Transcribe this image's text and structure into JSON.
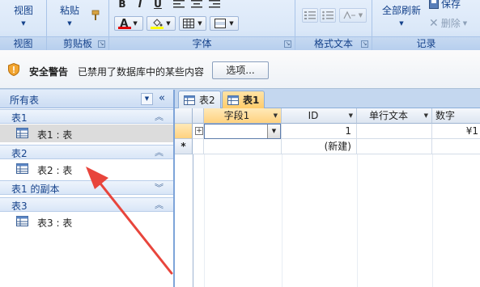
{
  "ribbon": {
    "groups": {
      "views": {
        "label": "视图",
        "button": "视图"
      },
      "clipboard": {
        "label": "剪贴板",
        "paste": "粘贴"
      },
      "font": {
        "label": "字体",
        "bold": "B",
        "italic": "I",
        "underline": "U",
        "font_color_glyph": "A"
      },
      "rich_text": {
        "label": "格式文本"
      },
      "records": {
        "label": "记录",
        "refresh": "全部刷新",
        "save": "保存",
        "delete": "删除"
      }
    }
  },
  "message_bar": {
    "title": "安全警告",
    "text": "已禁用了数据库中的某些内容",
    "options_button": "选项..."
  },
  "nav_pane": {
    "title": "所有表",
    "groups": [
      {
        "name": "表1",
        "items": [
          {
            "label": "表1 : 表",
            "selected": true
          }
        ]
      },
      {
        "name": "表2",
        "items": [
          {
            "label": "表2 : 表",
            "selected": false
          }
        ]
      },
      {
        "name": "表1 的副本",
        "items": []
      },
      {
        "name": "表3",
        "items": [
          {
            "label": "表3 : 表",
            "selected": false
          }
        ]
      }
    ]
  },
  "tabs": [
    {
      "label": "表2",
      "active": false
    },
    {
      "label": "表1",
      "active": true
    }
  ],
  "datasheet": {
    "columns": [
      "字段1",
      "ID",
      "单行文本",
      "数字"
    ],
    "rows": [
      {
        "selector": "",
        "field1": "",
        "id": "1",
        "text": "",
        "number": "¥1"
      },
      {
        "selector": "*",
        "field1": "",
        "id": "(新建)",
        "text": "",
        "number": ""
      }
    ]
  },
  "colors": {
    "accent_tab": "#ffcc6b",
    "annotation_arrow": "#e8453c",
    "font_color_bar": "#e00000",
    "highlight_bar": "#ffff00"
  }
}
